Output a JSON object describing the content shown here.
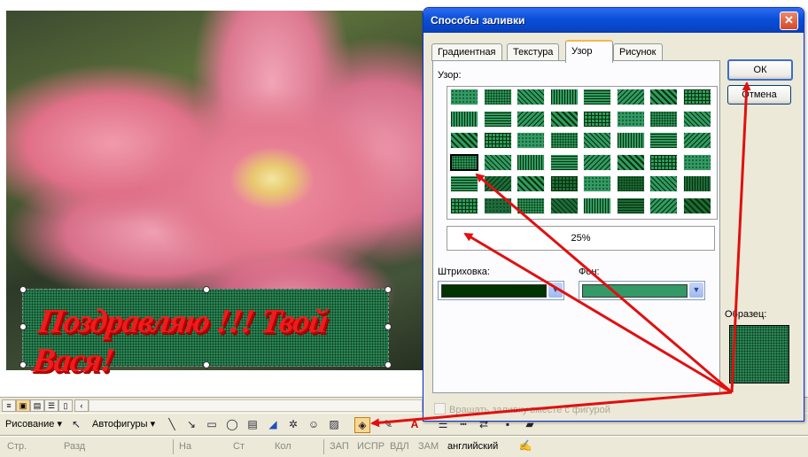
{
  "dialog": {
    "title": "Способы заливки",
    "close_glyph": "✕",
    "tabs": [
      "Градиентная",
      "Текстура",
      "Узор",
      "Рисунок"
    ],
    "active_tab": "Узор",
    "pattern_label": "Узор:",
    "selected_pattern": "25%",
    "hatch_label": "Штриховка:",
    "background_label": "Фон:",
    "hatch_color": "#003300",
    "background_color": "#339966",
    "ok_label": "ОК",
    "cancel_label": "Отмена",
    "sample_label": "Образец:",
    "rotate_label": "Вращать заливку вместе с фигурой",
    "dropdown_arrow": "▼"
  },
  "document": {
    "wordart_text": "Поздравляю !!! Твой Вася!"
  },
  "drawing_toolbar": {
    "drawing_label": "Рисование ▾",
    "autoshapes_label": "Автофигуры ▾"
  },
  "status_bar": {
    "page": "Стр.",
    "section": "Разд",
    "at": "На",
    "line": "Ст",
    "column": "Кол",
    "rec": "ЗАП",
    "trk": "ИСПР",
    "ext": "ВДЛ",
    "ovr": "ЗАМ",
    "language": "английский"
  },
  "colors": {
    "accent": "#0a4fd8",
    "arrow": "#e01010"
  }
}
